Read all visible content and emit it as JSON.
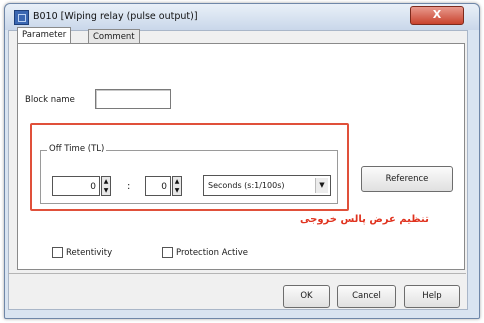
{
  "window": {
    "title": "B010 [Wiping relay (pulse output)]",
    "close_label": "X"
  },
  "tabs": [
    {
      "label": "Parameter",
      "active": true
    },
    {
      "label": "Comment",
      "active": false
    }
  ],
  "block_name": {
    "label": "Block name",
    "value": ""
  },
  "off_time": {
    "group_label": "Off Time (TL)",
    "first_value": "0",
    "separator": ":",
    "second_value": "0",
    "unit_selected": "Seconds (s:1/100s)"
  },
  "reference_label": "Reference",
  "annotation_text": "تنظیم عرض پالس خروجی",
  "checkboxes": [
    {
      "label": "Retentivity",
      "checked": false
    },
    {
      "label": "Protection Active",
      "checked": false
    }
  ],
  "buttons": {
    "ok": "OK",
    "cancel": "Cancel",
    "help": "Help"
  },
  "colors": {
    "highlight_box": "#e0503a",
    "annotation": "#e0321e",
    "close_button": "#c9432e"
  },
  "icons": {
    "app": "block-icon",
    "spin_up": "triangle-up",
    "spin_down": "triangle-down",
    "dropdown": "chevron-down"
  }
}
